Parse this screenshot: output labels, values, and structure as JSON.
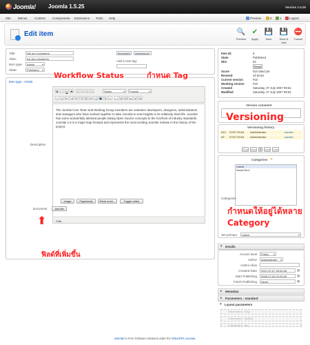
{
  "header": {
    "logo_text": "Joomla!",
    "site_name": "Joomla 1.5.25",
    "version": "Version 1.5.25"
  },
  "menubar": {
    "items": [
      "Site",
      "Menus",
      "Content",
      "Components",
      "Extensions",
      "Tools",
      "Help"
    ],
    "right": {
      "preview": "Preview",
      "messages": "0",
      "users": "1",
      "logout": "Logout"
    }
  },
  "toolbar": {
    "title": "Edit item",
    "buttons": [
      {
        "label": "Preview",
        "icon": "preview-icon"
      },
      {
        "label": "Apply",
        "icon": "apply-icon"
      },
      {
        "label": "Save",
        "icon": "save-icon"
      },
      {
        "label": "Save & new",
        "icon": "save-new-icon"
      },
      {
        "label": "Cancel",
        "icon": "cancel-icon"
      }
    ]
  },
  "form": {
    "title_label": "Title:",
    "title_value": "We are Volunteers",
    "alias_label": "Alias:",
    "alias_value": "we-are-volunteers",
    "type_label": "Item type:",
    "type_value": "Article",
    "state_label": "State:",
    "state_value": "Published",
    "tags": [
      "document",
      "opensource"
    ],
    "add_tag_label": "Add a new tag:",
    "item_type_link_label": "Item type : ",
    "item_type_link_value": "Article",
    "description_label": "Description",
    "document_label": "Document",
    "add_file_button": "Add file"
  },
  "editor": {
    "styles_value": "Styles",
    "format_value": "Format",
    "body_text": "The Joomla Core Team and Working Group members are volunteer developers, designers, administrators and managers who have worked together to take Joomla! to new heights in its relatively short life. Joomla! has some wonderfully talented people taking Open Source concepts to the forefront of industry standards. Joomla! 1.5 is a major leap forward and represents the most exciting Joomla! release in the history of the project.",
    "path_label": "Path:",
    "buttons": [
      "Image",
      "Pagebreak",
      "Read more...",
      "Toggle editor"
    ]
  },
  "annotations": {
    "workflow": "Workflow Status",
    "tag": "กำหนด Tag",
    "versioning": "Versioning",
    "category": "กำหนดให้อยู่ได้หลาย Category",
    "extra_field": "ฟิลด์ที่เพิ่มขึ้น",
    "color": "#ff2222"
  },
  "info": {
    "rows": [
      {
        "k": "Item ID:",
        "v": "6"
      },
      {
        "k": "State",
        "v": "Published"
      },
      {
        "k": "Hits",
        "v": "54"
      },
      {
        "k": "Score",
        "v": "Not rated yet"
      },
      {
        "k": "Revised",
        "v": "10 times"
      },
      {
        "k": "Current version",
        "v": "#10"
      },
      {
        "k": "Working version",
        "v": "#10"
      },
      {
        "k": "Created",
        "v": "Saturday, 07 July 2007 09:54"
      },
      {
        "k": "Modified",
        "v": "Saturday, 07 July 2007 09:54"
      }
    ],
    "reset_button": "Reset"
  },
  "version": {
    "comment_label": "Version comment",
    "history_label": "Versioning history",
    "rows": [
      {
        "ver": "#10",
        "date": "07/07 09:54",
        "author": "Administrator",
        "status": "current"
      },
      {
        "ver": "#9",
        "date": "07/07 09:54",
        "author": "Administrator",
        "status": "current"
      }
    ],
    "pager": [
      "First",
      "Prev",
      "1",
      "Next",
      "Last"
    ]
  },
  "categories": {
    "heading": "Categories",
    "label": "Categories",
    "options": [
      "Latest",
      "News/Tech"
    ],
    "primary_label": "Set primary",
    "primary_value": "Latest"
  },
  "details": {
    "heading": "Details",
    "fields": [
      {
        "k": "Access level",
        "v": "Public",
        "kind": "select"
      },
      {
        "k": "Author",
        "v": "Administrator",
        "kind": "select"
      },
      {
        "k": "Author Alias",
        "v": "",
        "kind": "text"
      },
      {
        "k": "Created Date",
        "v": "2007-07-07 09:54:06",
        "kind": "date"
      },
      {
        "k": "Start Publishing",
        "v": "2006-07-06 22:00:00",
        "kind": "date"
      },
      {
        "k": "Finish Publishing",
        "v": "Never",
        "kind": "date"
      }
    ],
    "metadata": "Metadata",
    "params_standard": "Parameters : standard",
    "layout_params": "Layout parameters",
    "params_blog": "Parameters : blog",
    "params_default": "Parameters : default",
    "params_faq": "Parameters : faq"
  },
  "footer": {
    "brand": "Joomla!",
    "text": " is Free Software released under the ",
    "license": "GNU/GPL License."
  }
}
